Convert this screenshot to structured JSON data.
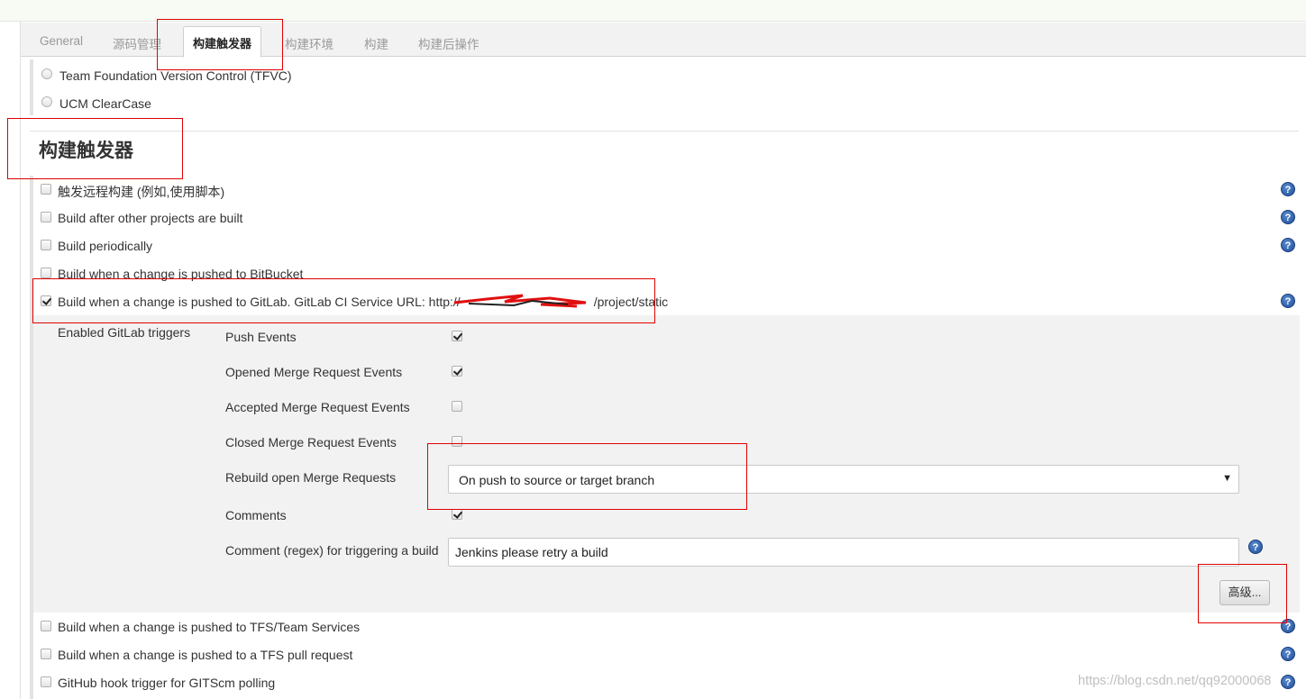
{
  "tabs": [
    "General",
    "源码管理",
    "构建触发器",
    "构建环境",
    "构建",
    "构建后操作"
  ],
  "scm_options": [
    "Team Foundation Version Control (TFVC)",
    "UCM ClearCase"
  ],
  "section_title": "构建触发器",
  "triggers": {
    "remote": "触发远程构建 (例如,使用脚本)",
    "after_other": "Build after other projects are built",
    "periodically": "Build periodically",
    "bitbucket": "Build when a change is pushed to BitBucket",
    "gitlab": "Build when a change is pushed to GitLab. GitLab CI Service URL: http://",
    "gitlab_url_tail": "/project/static",
    "tfs_services": "Build when a change is pushed to TFS/Team Services",
    "tfs_pull": "Build when a change is pushed to a TFS pull request",
    "github_hook": "GitHub hook trigger for GITScm polling"
  },
  "gitlab": {
    "enabled_triggers_label": "Enabled GitLab triggers",
    "push_events": "Push Events",
    "opened_mr": "Opened Merge Request Events",
    "accepted_mr": "Accepted Merge Request Events",
    "closed_mr": "Closed Merge Request Events",
    "rebuild_open_mr": "Rebuild open Merge Requests",
    "rebuild_value": "On push to source or target branch",
    "comments": "Comments",
    "comment_regex_label": "Comment (regex) for triggering a build",
    "comment_regex_value": "Jenkins please retry a build",
    "advanced_button": "高级..."
  },
  "help_glyph": "?",
  "select_arrow": "▼",
  "watermark": "https://blog.csdn.net/qq92000068"
}
